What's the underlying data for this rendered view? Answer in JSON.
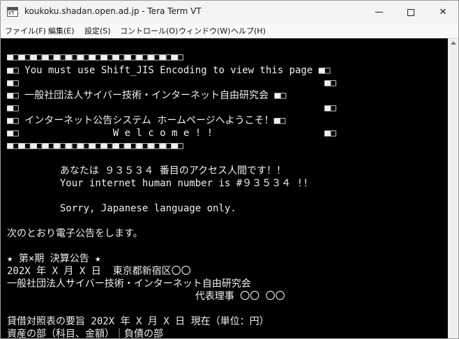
{
  "window": {
    "title": "koukoku.shadan.open.ad.jp - Tera Term VT",
    "icon_label": "VT",
    "minimize_icon": "minimize-icon",
    "maximize_icon": "maximize-icon",
    "close_glyph": "✕"
  },
  "menu": [
    {
      "label": "ファイル(F)"
    },
    {
      "label": "編集(E)"
    },
    {
      "label": "設定(S)"
    },
    {
      "label": "コントロール(O)"
    },
    {
      "label": "ウィンドウ(W)"
    },
    {
      "label": "ヘルプ(H)"
    }
  ],
  "terminal": {
    "lines": [
      "■□■□■□■□■□■□■□■□■□■□■□■□■□■□■□",
      "■□ You must use Shift_JIS Encoding to view this page ■□",
      "■□                                                    ■□",
      "■□ 一般社団法人サイバー技術・インターネット自由研究会 ■□",
      "■□                                                    ■□",
      "■□ インターネット公告システム ホームページへようこそ！■□",
      "■□                W e l c o m e ! !                   ■□",
      "■□■□■□■□■□■□■□■□■□■□■□■□■□■□■□",
      "",
      "         あなたは ９３５３４ 番目のアクセス人間です！！",
      "         Your internet human number is #９３５３４ !!",
      "",
      "         Sorry, Japanese language only.",
      "",
      "次のとおり電子公告をします。",
      "",
      "★ 第×期 決算公告 ★",
      "202X 年 X 月 X 日  東京都新宿区〇〇",
      "一般社団法人サイバー技術・インターネット自由研究会",
      "                                代表理事 〇〇 〇〇",
      "",
      "貸借対照表の要旨 202X 年 X 月 X 日 現在（単位：円）",
      "資産の部（科目、金額）｜負債の部"
    ]
  },
  "scrollbar": {
    "up_icon": "scroll-up-arrow-icon"
  }
}
